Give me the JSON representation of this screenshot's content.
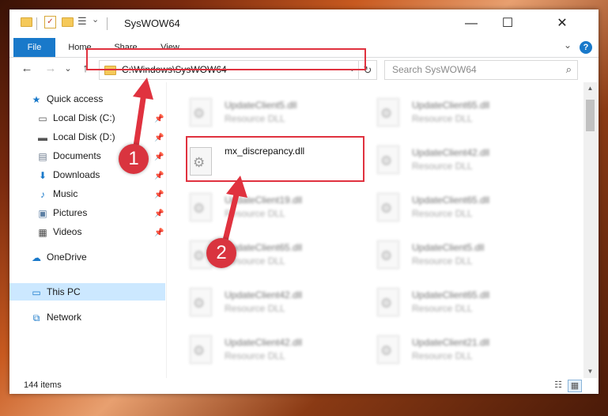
{
  "window": {
    "title": "SysWOW64",
    "minimize_icon": "minimize-icon",
    "maximize_icon": "maximize-icon",
    "close_icon": "close-icon",
    "minimize_glyph": "—",
    "maximize_glyph": "☐",
    "close_glyph": "✕"
  },
  "ribbon": {
    "tabs": [
      {
        "label": "File"
      },
      {
        "label": "Home"
      },
      {
        "label": "Share"
      },
      {
        "label": "View"
      }
    ],
    "help_glyph": "?",
    "expand_glyph": "⌄"
  },
  "nav": {
    "back_glyph": "←",
    "forward_glyph": "→",
    "recent_glyph": "⌄",
    "up_glyph": "↑",
    "address": "C:\\Windows\\SysWOW64",
    "address_dropdown_glyph": "⌄",
    "refresh_glyph": "↻",
    "search_placeholder": "Search SysWOW64",
    "search_glyph": "⌕"
  },
  "sidebar": {
    "items": [
      {
        "label": "Quick access",
        "icon": "star-icon",
        "glyph": "★",
        "color": "#1979ca"
      },
      {
        "label": "Local Disk (C:)",
        "icon": "drive-icon",
        "glyph": "▭",
        "color": "#555555",
        "pinned": true
      },
      {
        "label": "Local Disk (D:)",
        "icon": "drive-icon",
        "glyph": "▬",
        "color": "#555555",
        "pinned": true
      },
      {
        "label": "Documents",
        "icon": "documents-icon",
        "glyph": "▤",
        "color": "#6b7a8c",
        "pinned": true
      },
      {
        "label": "Downloads",
        "icon": "download-icon",
        "glyph": "⬇",
        "color": "#1979ca",
        "pinned": true
      },
      {
        "label": "Music",
        "icon": "music-icon",
        "glyph": "♪",
        "color": "#1979ca",
        "pinned": true
      },
      {
        "label": "Pictures",
        "icon": "pictures-icon",
        "glyph": "▣",
        "color": "#5c7fa3",
        "pinned": true
      },
      {
        "label": "Videos",
        "icon": "videos-icon",
        "glyph": "▦",
        "color": "#444444",
        "pinned": true
      },
      {
        "label": "OneDrive",
        "icon": "cloud-icon",
        "glyph": "☁",
        "color": "#1979ca"
      },
      {
        "label": "This PC",
        "icon": "computer-icon",
        "glyph": "▭",
        "color": "#1979ca",
        "selected": true
      },
      {
        "label": "Network",
        "icon": "network-icon",
        "glyph": "⧉",
        "color": "#1979ca"
      }
    ],
    "pin_glyph": "📌"
  },
  "files": {
    "left_column": [
      {
        "name": "UpdateClient5.dll",
        "type": "Resource DLL"
      },
      {
        "name": "mx_discrepancy.dll",
        "type": ""
      },
      {
        "name": "UpdateClient19.dll",
        "type": "Resource DLL"
      },
      {
        "name": "UpdateClient65.dll",
        "type": "Resource DLL"
      },
      {
        "name": "UpdateClient42.dll",
        "type": "Resource DLL"
      },
      {
        "name": "UpdateClient42.dll",
        "type": "Resource DLL"
      }
    ],
    "right_column": [
      {
        "name": "UpdateClient65.dll",
        "type": "Resource DLL"
      },
      {
        "name": "UpdateClient42.dll",
        "type": "Resource DLL"
      },
      {
        "name": "UpdateClient65.dll",
        "type": "Resource DLL"
      },
      {
        "name": "UpdateClient5.dll",
        "type": "Resource DLL"
      },
      {
        "name": "UpdateClient65.dll",
        "type": "Resource DLL"
      },
      {
        "name": "UpdateClient21.dll",
        "type": "Resource DLL"
      }
    ]
  },
  "status": {
    "item_count": "144 items",
    "details_view_glyph": "☷",
    "tiles_view_glyph": "▦"
  },
  "annotations": {
    "step1": "1",
    "step2": "2",
    "color": "#e0323f"
  }
}
